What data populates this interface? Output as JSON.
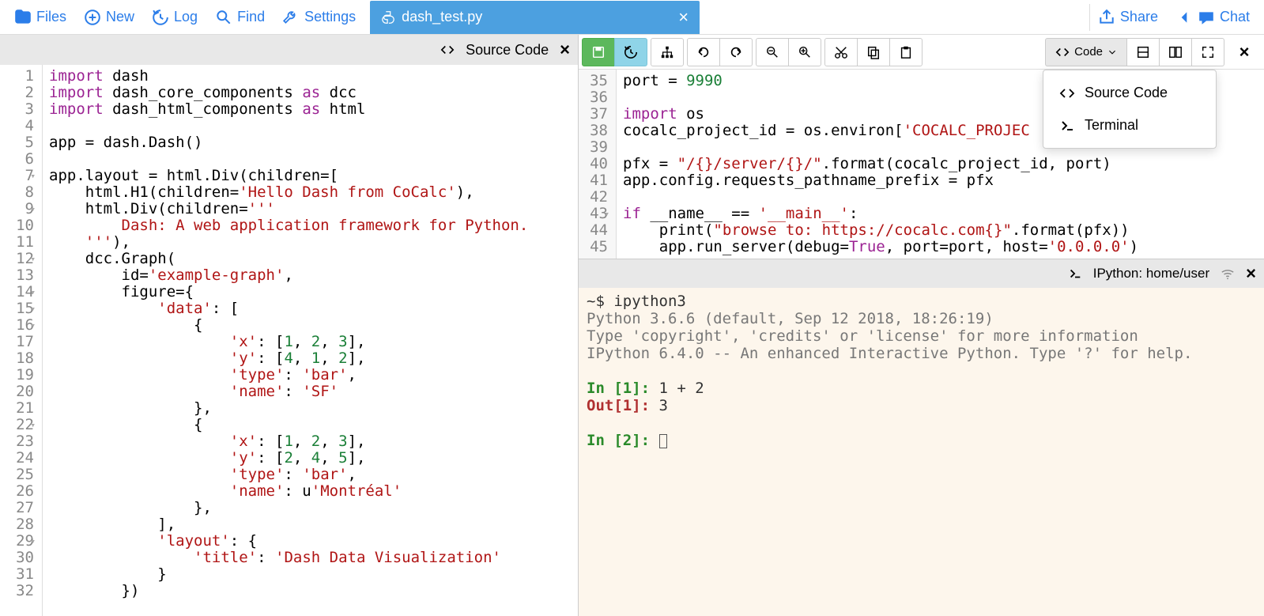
{
  "toolbar": {
    "files": "Files",
    "new": "New",
    "log": "Log",
    "find": "Find",
    "settings": "Settings",
    "share": "Share",
    "chat": "Chat"
  },
  "tab": {
    "filename": "dash_test.py"
  },
  "leftHeader": {
    "title": "Source Code"
  },
  "leftGutter": [
    "1",
    "2",
    "3",
    "4",
    "5",
    "6",
    "7",
    "8",
    "9",
    "10",
    "11",
    "12",
    "13",
    "14",
    "15",
    "16",
    "17",
    "18",
    "19",
    "20",
    "21",
    "22",
    "23",
    "24",
    "25",
    "26",
    "27",
    "28",
    "29",
    "30",
    "31",
    "32"
  ],
  "leftFold": {
    "7": true,
    "9": true,
    "12": true,
    "14": true,
    "15": true,
    "16": true,
    "22": true,
    "29": true
  },
  "leftCode": [
    [
      [
        "k",
        "import"
      ],
      [
        "",
        " dash"
      ]
    ],
    [
      [
        "k",
        "import"
      ],
      [
        "",
        " dash_core_components "
      ],
      [
        "k",
        "as"
      ],
      [
        "",
        " dcc"
      ]
    ],
    [
      [
        "k",
        "import"
      ],
      [
        "",
        " dash_html_components "
      ],
      [
        "k",
        "as"
      ],
      [
        "",
        " html"
      ]
    ],
    [
      [
        "",
        ""
      ]
    ],
    [
      [
        "",
        "app = dash.Dash()"
      ]
    ],
    [
      [
        "",
        ""
      ]
    ],
    [
      [
        "",
        "app.layout = html.Div(children=["
      ]
    ],
    [
      [
        "",
        "    html.H1(children="
      ],
      [
        "s",
        "'Hello Dash from CoCalc'"
      ],
      [
        "",
        "),"
      ]
    ],
    [
      [
        "",
        "    html.Div(children="
      ],
      [
        "s",
        "'''"
      ]
    ],
    [
      [
        "s",
        "        Dash: A web application framework for Python."
      ]
    ],
    [
      [
        "s",
        "    '''"
      ],
      [
        "",
        "),"
      ]
    ],
    [
      [
        "",
        "    dcc.Graph("
      ]
    ],
    [
      [
        "",
        "        id="
      ],
      [
        "s",
        "'example-graph'"
      ],
      [
        "",
        ","
      ]
    ],
    [
      [
        "",
        "        figure={"
      ]
    ],
    [
      [
        "",
        "            "
      ],
      [
        "s",
        "'data'"
      ],
      [
        "",
        ": ["
      ]
    ],
    [
      [
        "",
        "                {"
      ]
    ],
    [
      [
        "",
        "                    "
      ],
      [
        "s",
        "'x'"
      ],
      [
        "",
        ": ["
      ],
      [
        "n",
        "1"
      ],
      [
        "",
        ", "
      ],
      [
        "n",
        "2"
      ],
      [
        "",
        ", "
      ],
      [
        "n",
        "3"
      ],
      [
        "",
        "],"
      ]
    ],
    [
      [
        "",
        "                    "
      ],
      [
        "s",
        "'y'"
      ],
      [
        "",
        ": ["
      ],
      [
        "n",
        "4"
      ],
      [
        "",
        ", "
      ],
      [
        "n",
        "1"
      ],
      [
        "",
        ", "
      ],
      [
        "n",
        "2"
      ],
      [
        "",
        "],"
      ]
    ],
    [
      [
        "",
        "                    "
      ],
      [
        "s",
        "'type'"
      ],
      [
        "",
        ": "
      ],
      [
        "s",
        "'bar'"
      ],
      [
        "",
        ","
      ]
    ],
    [
      [
        "",
        "                    "
      ],
      [
        "s",
        "'name'"
      ],
      [
        "",
        ": "
      ],
      [
        "s",
        "'SF'"
      ]
    ],
    [
      [
        "",
        "                },"
      ]
    ],
    [
      [
        "",
        "                {"
      ]
    ],
    [
      [
        "",
        "                    "
      ],
      [
        "s",
        "'x'"
      ],
      [
        "",
        ": ["
      ],
      [
        "n",
        "1"
      ],
      [
        "",
        ", "
      ],
      [
        "n",
        "2"
      ],
      [
        "",
        ", "
      ],
      [
        "n",
        "3"
      ],
      [
        "",
        "],"
      ]
    ],
    [
      [
        "",
        "                    "
      ],
      [
        "s",
        "'y'"
      ],
      [
        "",
        ": ["
      ],
      [
        "n",
        "2"
      ],
      [
        "",
        ", "
      ],
      [
        "n",
        "4"
      ],
      [
        "",
        ", "
      ],
      [
        "n",
        "5"
      ],
      [
        "",
        "],"
      ]
    ],
    [
      [
        "",
        "                    "
      ],
      [
        "s",
        "'type'"
      ],
      [
        "",
        ": "
      ],
      [
        "s",
        "'bar'"
      ],
      [
        "",
        ","
      ]
    ],
    [
      [
        "",
        "                    "
      ],
      [
        "s",
        "'name'"
      ],
      [
        "",
        ": u"
      ],
      [
        "s",
        "'Montréal'"
      ]
    ],
    [
      [
        "",
        "                },"
      ]
    ],
    [
      [
        "",
        "            ],"
      ]
    ],
    [
      [
        "",
        "            "
      ],
      [
        "s",
        "'layout'"
      ],
      [
        "",
        ": {"
      ]
    ],
    [
      [
        "",
        "                "
      ],
      [
        "s",
        "'title'"
      ],
      [
        "",
        ": "
      ],
      [
        "s",
        "'Dash Data Visualization'"
      ]
    ],
    [
      [
        "",
        "            }"
      ]
    ],
    [
      [
        "",
        "        })"
      ]
    ]
  ],
  "codeBtn": {
    "label": "Code"
  },
  "dropdown": {
    "item1": "Source Code",
    "item2": "Terminal"
  },
  "rightGutter": [
    "35",
    "36",
    "37",
    "38",
    "39",
    "40",
    "41",
    "42",
    "43",
    "44",
    "45"
  ],
  "rightFold": {
    "43": true
  },
  "rightCode": [
    [
      [
        "",
        "port = "
      ],
      [
        "n",
        "9990"
      ]
    ],
    [
      [
        "",
        ""
      ]
    ],
    [
      [
        "k",
        "import"
      ],
      [
        "",
        " os"
      ]
    ],
    [
      [
        "",
        "cocalc_project_id = os.environ["
      ],
      [
        "s",
        "'COCALC_PROJEC"
      ]
    ],
    [
      [
        "",
        ""
      ]
    ],
    [
      [
        "",
        "pfx = "
      ],
      [
        "s",
        "\"/{}/server/{}/\""
      ],
      [
        "",
        ".format(cocalc_project_id, port)"
      ]
    ],
    [
      [
        "",
        "app.config.requests_pathname_prefix = pfx"
      ]
    ],
    [
      [
        "",
        ""
      ]
    ],
    [
      [
        "k",
        "if"
      ],
      [
        "",
        " __name__ == "
      ],
      [
        "s",
        "'__main__'"
      ],
      [
        "",
        ":"
      ]
    ],
    [
      [
        "",
        "    print("
      ],
      [
        "s",
        "\"browse to: https://cocalc.com{}\""
      ],
      [
        "",
        ".format(pfx))"
      ]
    ],
    [
      [
        "",
        "    app.run_server(debug="
      ],
      [
        "k",
        "True"
      ],
      [
        "",
        ", port=port, host="
      ],
      [
        "s",
        "'0.0.0.0'"
      ],
      [
        "",
        ")"
      ]
    ]
  ],
  "termHeader": {
    "title": "IPython: home/user"
  },
  "terminal": {
    "l1": "~$ ipython3",
    "l2": "Python 3.6.6 (default, Sep 12 2018, 18:26:19)",
    "l3": "Type 'copyright', 'credits' or 'license' for more information",
    "l4": "IPython 6.4.0 -- An enhanced Interactive Python. Type '?' for help.",
    "in1a": "In [",
    "in1b": "1",
    "in1c": "]: ",
    "in1cmd": "1 + 2",
    "out1a": "Out[",
    "out1b": "1",
    "out1c": "]: ",
    "out1val": "3",
    "in2a": "In [",
    "in2b": "2",
    "in2c": "]: "
  }
}
